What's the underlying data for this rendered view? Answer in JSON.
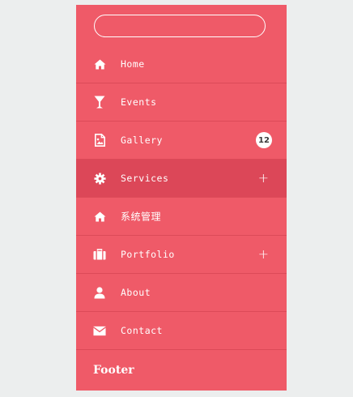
{
  "search": {
    "placeholder": "",
    "value": ""
  },
  "nav": {
    "items": [
      {
        "label": "Home",
        "icon": "home-icon"
      },
      {
        "label": "Events",
        "icon": "cocktail-icon"
      },
      {
        "label": "Gallery",
        "icon": "image-file-icon",
        "badge": "12"
      },
      {
        "label": "Services",
        "icon": "gear-icon",
        "expand": "+",
        "active": true
      },
      {
        "label": "系统管理",
        "icon": "home-icon"
      },
      {
        "label": "Portfolio",
        "icon": "briefcase-icon",
        "expand": "+"
      },
      {
        "label": "About",
        "icon": "user-icon"
      },
      {
        "label": "Contact",
        "icon": "envelope-icon"
      }
    ]
  },
  "footer": {
    "title": "Footer"
  },
  "colors": {
    "panel": "#ef5a68",
    "active": "#dc4758",
    "divider": "#dc4a58",
    "page_background": "#eceeee"
  }
}
